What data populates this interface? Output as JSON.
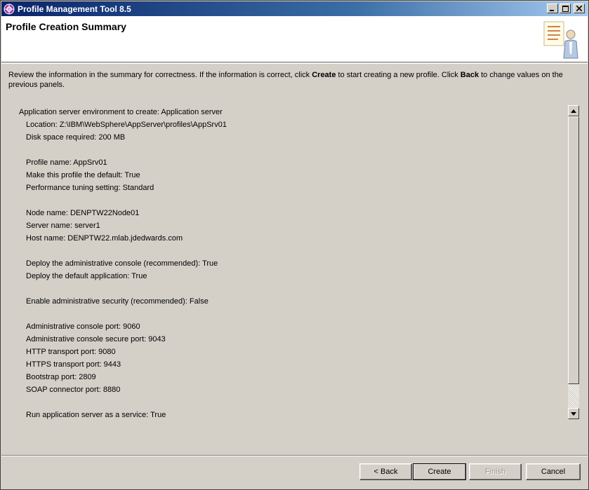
{
  "window": {
    "title": "Profile Management Tool 8.5",
    "buttons": {
      "minimize": "_",
      "maximize": "□",
      "close": "×"
    }
  },
  "header": {
    "title": "Profile Creation Summary"
  },
  "instruction": {
    "part1": "Review the information in the summary for correctness. If the information is correct, click ",
    "create_word": "Create",
    "part2": " to start creating a new profile. Click ",
    "back_word": "Back",
    "part3": " to change values on the previous panels."
  },
  "summary": {
    "environment": "Application server environment to create: Application server",
    "location": "Location: Z:\\IBM\\WebSphere\\AppServer\\profiles\\AppSrv01",
    "disk_space": "Disk space required: 200 MB",
    "profile_name": "Profile name: AppSrv01",
    "default_profile": "Make this profile the default: True",
    "tuning": "Performance tuning setting: Standard",
    "node_name": "Node name: DENPTW22Node01",
    "server_name": "Server name: server1",
    "host_name": "Host name: DENPTW22.mlab.jdedwards.com",
    "admin_console": "Deploy the administrative console (recommended): True",
    "default_app": "Deploy the default application: True",
    "admin_security": "Enable administrative security (recommended): False",
    "admin_port": "Administrative console port: 9060",
    "admin_secure_port": "Administrative console secure port: 9043",
    "http_port": "HTTP transport port: 9080",
    "https_port": "HTTPS transport port: 9443",
    "bootstrap_port": "Bootstrap port: 2809",
    "soap_port": "SOAP connector port: 8880",
    "service": "Run application server as a service: True"
  },
  "buttons": {
    "back": "< Back",
    "create": "Create",
    "finish": "Finish",
    "cancel": "Cancel"
  }
}
